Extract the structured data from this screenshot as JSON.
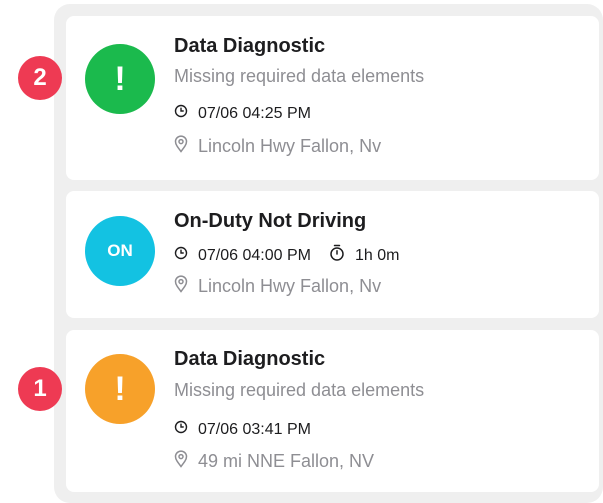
{
  "colors": {
    "panel_bg": "#efefef",
    "card_bg": "#ffffff",
    "badge_red": "#ee3a53",
    "green": "#1bba4d",
    "cyan": "#13c2e2",
    "orange": "#f7a12a",
    "text_primary": "#1d1d1f",
    "text_secondary": "#8e8e93"
  },
  "events": [
    {
      "badge": "2",
      "status_glyph": "!",
      "status_color": "green",
      "title": "Data Diagnostic",
      "subtitle": "Missing required data elements",
      "time": "07/06 04:25 PM",
      "location": "Lincoln Hwy Fallon, Nv"
    },
    {
      "status_glyph": "ON",
      "status_color": "cyan",
      "title": "On-Duty Not Driving",
      "time": "07/06 04:00 PM",
      "duration": "1h 0m",
      "location": "Lincoln Hwy Fallon, Nv"
    },
    {
      "badge": "1",
      "status_glyph": "!",
      "status_color": "orange",
      "title": "Data Diagnostic",
      "subtitle": "Missing required data elements",
      "time": "07/06 03:41 PM",
      "location": "49 mi NNE Fallon, NV"
    }
  ],
  "icons": {
    "time": "clock-icon",
    "duration": "stopwatch-icon",
    "location": "location-pin-icon"
  }
}
